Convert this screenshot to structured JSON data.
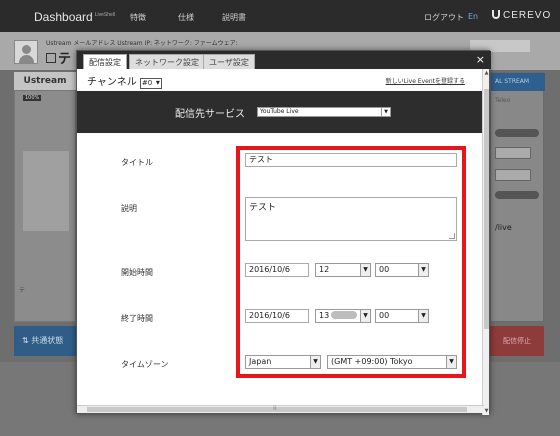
{
  "topbar": {
    "brand": "Dashboard",
    "brand_sup": "LiveShell",
    "nav": [
      "特徴",
      "仕様",
      "説明書"
    ],
    "logout": "ログアウト",
    "lang": "En",
    "logo": "CEREVO"
  },
  "infobar": {
    "line1": "Ustream メールアドレス Ustream IP:  ネットワーク:  ファームウェア:",
    "device_name": "テ"
  },
  "left": {
    "tab": "Ustream",
    "badge": "100%",
    "button": "テ",
    "share": "共通状態"
  },
  "right": {
    "live_label": "AL STREAM",
    "tab": "Teleo",
    "text": "/live",
    "red_label": "配信停止"
  },
  "modal": {
    "tabs": [
      {
        "label": "配信設定",
        "active": true
      },
      {
        "label": "ネットワーク設定",
        "active": false
      },
      {
        "label": "ユーザ設定",
        "active": false
      }
    ],
    "close": "×",
    "channel_label": "チャンネル",
    "channel_value": "#0",
    "new_link": "新しいLive Eventを登録する",
    "destination_label": "配信先サービス",
    "destination_value": "YouTube Live",
    "title_label": "タイトル",
    "title_value": "テスト",
    "description_label": "説明",
    "description_value": "テスト",
    "start_label": "開始時間",
    "start_date": "2016/10/6",
    "start_hour": "12",
    "start_min": "00",
    "end_label": "終了時間",
    "end_date": "2016/10/6",
    "end_hour": "13",
    "end_min": "00",
    "timezone_label": "タイムゾーン",
    "timezone_region": "Japan",
    "timezone_value": "(GMT +09:00) Tokyo"
  },
  "colors": {
    "highlight": "#e8161a",
    "dark_bar": "#2d2d2d",
    "accent_blue": "#2e5f8e"
  }
}
